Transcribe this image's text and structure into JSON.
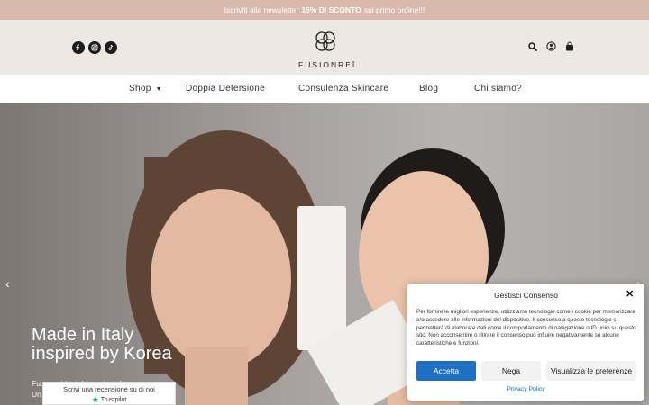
{
  "announcement": {
    "pre": "Iscriviti alla newsletter",
    "highlight": "15% DI SCONTO",
    "post": "sul primo ordine!!!"
  },
  "header": {
    "brand": "FUSIONREÏ",
    "socials": [
      "facebook-icon",
      "instagram-icon",
      "tiktok-icon"
    ],
    "actions": [
      "search-icon",
      "account-icon",
      "cart-icon"
    ]
  },
  "nav": {
    "items": [
      "Shop",
      "Doppia Detersione",
      "Consulenza Skincare",
      "Blog",
      "Chi siamo?"
    ]
  },
  "hero": {
    "title_line1": "Made in Italy",
    "title_line2": "inspired by Korea",
    "sub_line1": "Fu... occidentale e orientale.",
    "sub_line2": "Un... affinate tecniche orientali."
  },
  "trustpilot": {
    "text": "Scrivi una recensione su di noi",
    "brand": "Trustpilot"
  },
  "consent": {
    "title": "Gestisci Consenso",
    "body": "Per fornire le migliori esperienze, utilizziamo tecnologie come i cookie per memorizzare e/o accedere alle informazioni del dispositivo. Il consenso a queste tecnologie ci permetterà di elaborare dati come il comportamento di navigazione o ID unici su questo sito. Non acconsentire o ritirare il consenso può influire negativamente su alcune caratteristiche e funzioni.",
    "accept": "Accetta",
    "deny": "Nega",
    "prefs": "Visualizza le preferenze",
    "privacy": "Privacy Policy"
  },
  "colors": {
    "announce_bg": "#d9b8ae",
    "header_bg": "#ede9e2",
    "accept_bg": "#1f6fc5"
  }
}
